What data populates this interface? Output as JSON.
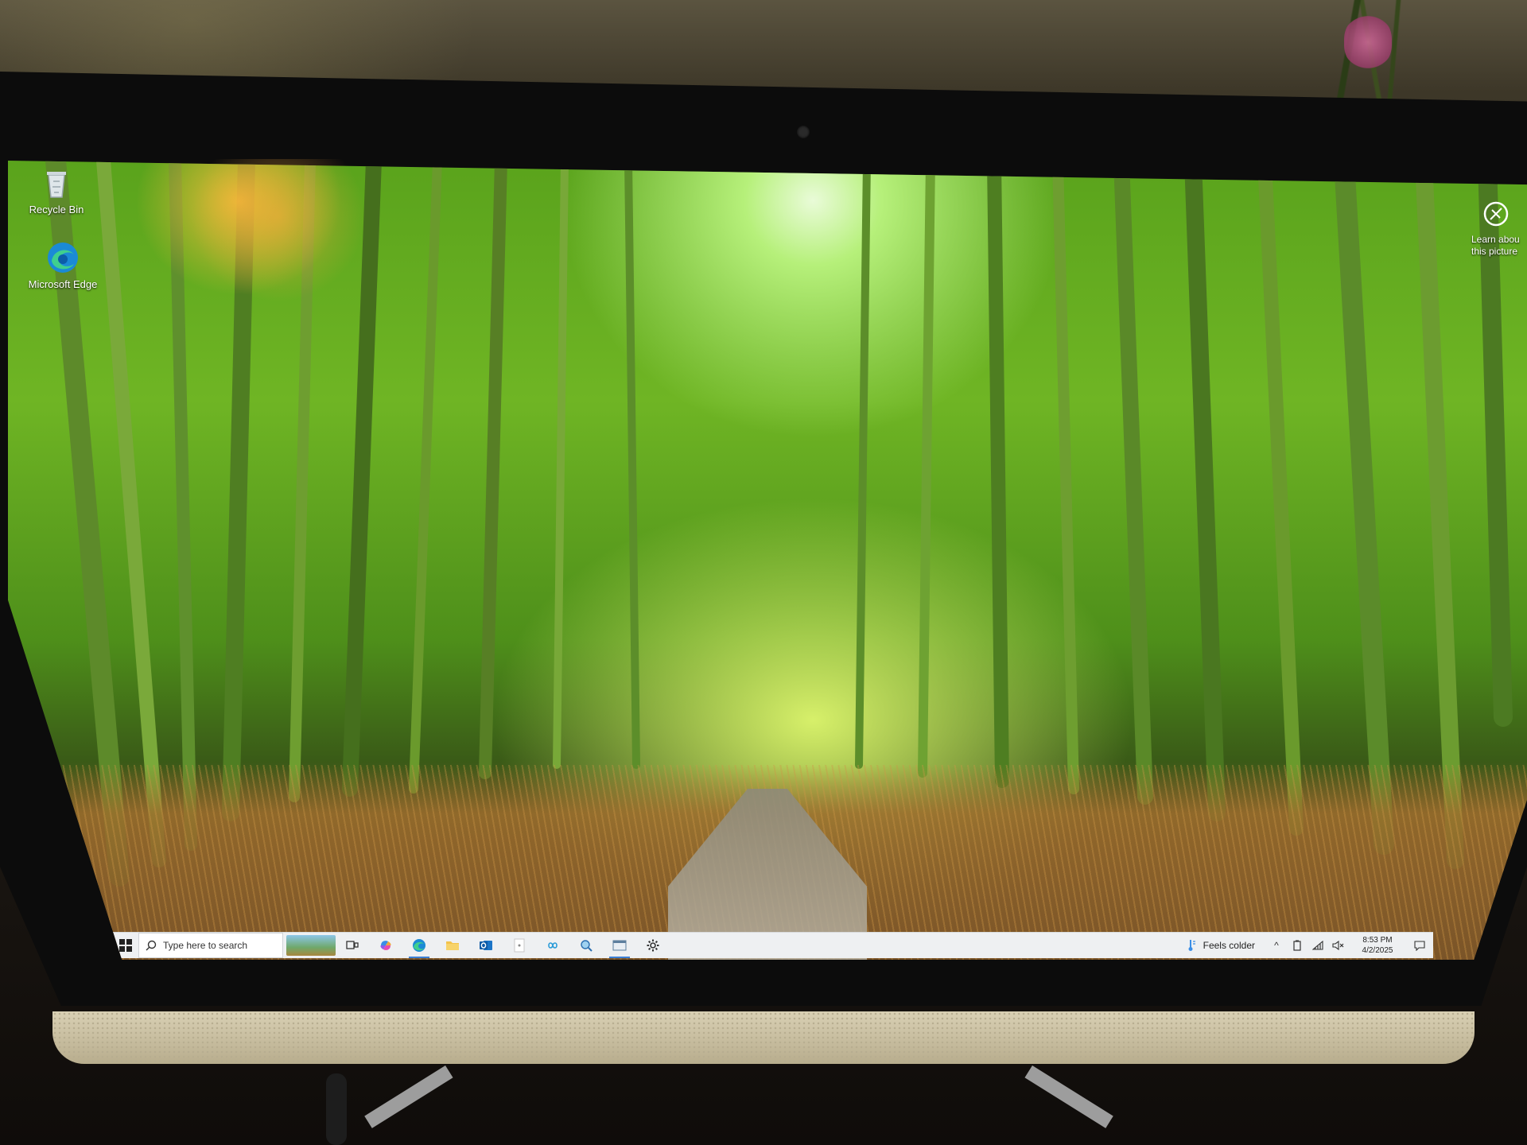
{
  "desktop": {
    "icons": [
      {
        "label": "Recycle Bin",
        "icon": "recycle-bin-icon"
      },
      {
        "label": "Microsoft Edge",
        "icon": "edge-icon"
      }
    ],
    "picture_info": {
      "line1": "Learn abou",
      "line2": "this picture",
      "icon": "camera-lens-icon"
    }
  },
  "taskbar": {
    "search_placeholder": "Type here to search",
    "apps": [
      {
        "name": "task-view",
        "icon": "task-view-icon"
      },
      {
        "name": "copilot",
        "icon": "copilot-icon"
      },
      {
        "name": "edge",
        "icon": "edge-icon"
      },
      {
        "name": "file-explorer",
        "icon": "folder-icon"
      },
      {
        "name": "outlook",
        "icon": "outlook-icon"
      },
      {
        "name": "app-white",
        "icon": "white-app-icon"
      },
      {
        "name": "app-link",
        "icon": "infinity-icon"
      },
      {
        "name": "app-search",
        "icon": "magnifier-app-icon"
      },
      {
        "name": "app-window",
        "icon": "window-app-icon"
      },
      {
        "name": "settings",
        "icon": "gear-icon"
      }
    ],
    "weather": "Feels colder",
    "tray": {
      "chevron": "^"
    },
    "clock": {
      "time": "8:53 PM",
      "date": "4/2/2025"
    }
  },
  "colors": {
    "taskbar_bg": "#eef0f2",
    "accent": "#3b7fd4"
  }
}
